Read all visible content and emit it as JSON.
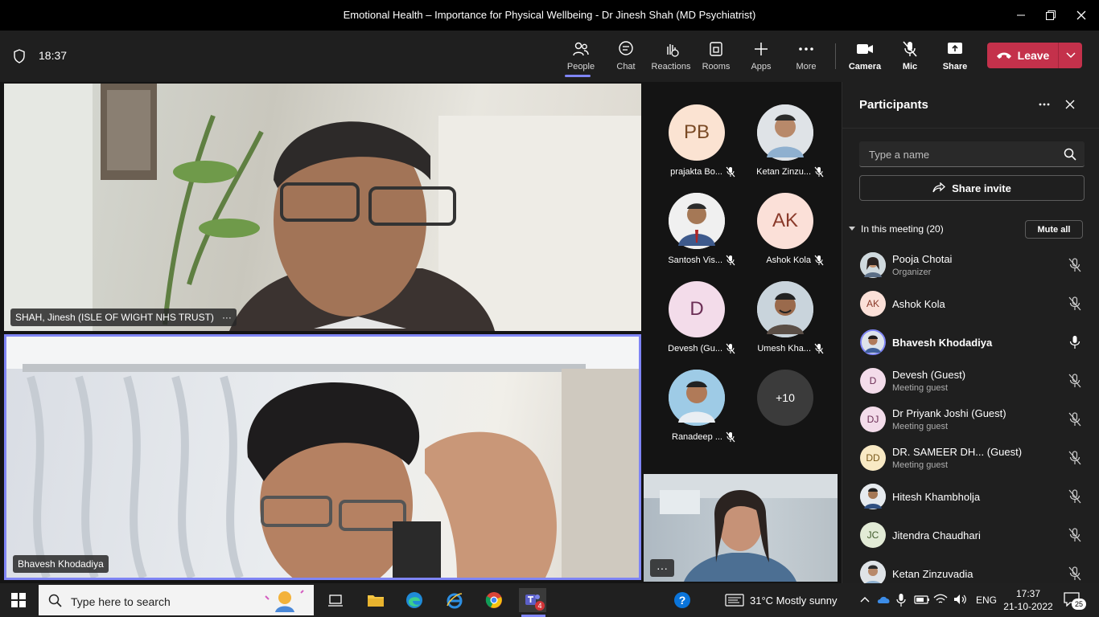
{
  "window": {
    "title": "Emotional Health – Importance for Physical Wellbeing - Dr Jinesh Shah (MD Psychiatrist)"
  },
  "toolbar": {
    "timer": "18:37",
    "people": "People",
    "chat": "Chat",
    "reactions": "Reactions",
    "rooms": "Rooms",
    "apps": "Apps",
    "more": "More",
    "camera": "Camera",
    "mic": "Mic",
    "share": "Share",
    "leave": "Leave"
  },
  "stage": {
    "speaker1": {
      "name": "SHAH, Jinesh (ISLE OF WIGHT NHS TRUST)",
      "more": "···"
    },
    "speaker2": {
      "name": "Bhavesh Khodadiya"
    },
    "small_more": "···",
    "tiles": [
      {
        "initials": "PB",
        "name": "prajakta Bo...",
        "bg": "#fbe3d2",
        "fg": "#7a4a25"
      },
      {
        "initials": "",
        "name": "Ketan Zinzu...",
        "bg": "#cfd6dc",
        "fg": "#333"
      },
      {
        "initials": "",
        "name": "Santosh Vis...",
        "bg": "#e2e2e2",
        "fg": "#333"
      },
      {
        "initials": "AK",
        "name": "Ashok Kola",
        "bg": "#fbe0d8",
        "fg": "#8a3a2a"
      },
      {
        "initials": "D",
        "name": "Devesh (Gu...",
        "bg": "#f3dcea",
        "fg": "#6b2e55"
      },
      {
        "initials": "",
        "name": "Umesh Kha...",
        "bg": "#d7dbdf",
        "fg": "#333"
      },
      {
        "initials": "",
        "name": "Ranadeep ...",
        "bg": "#a9cfe8",
        "fg": "#333"
      },
      {
        "initials": "+10",
        "name": "",
        "bg": "#3b3b3b",
        "fg": "#fff"
      }
    ]
  },
  "panel": {
    "title": "Participants",
    "search_placeholder": "Type a name",
    "share_invite": "Share invite",
    "section": "In this meeting (20)",
    "mute_all": "Mute all",
    "participants": [
      {
        "name": "Pooja Chotai",
        "sub": "Organizer",
        "initials": "",
        "bg": "#d9c4b8"
      },
      {
        "name": "Ashok Kola",
        "sub": "",
        "initials": "AK",
        "bg": "#fbe0d8"
      },
      {
        "name": "Bhavesh Khodadiya",
        "sub": "",
        "initials": "",
        "bg": "#c7d0e0"
      },
      {
        "name": "Devesh (Guest)",
        "sub": "Meeting guest",
        "initials": "D",
        "bg": "#f3dcea"
      },
      {
        "name": "Dr Priyank Joshi (Guest)",
        "sub": "Meeting guest",
        "initials": "DJ",
        "bg": "#f3dcea"
      },
      {
        "name": "DR. SAMEER DH...  (Guest)",
        "sub": "Meeting guest",
        "initials": "DD",
        "bg": "#f8e9c4"
      },
      {
        "name": "Hitesh Khambholja",
        "sub": "",
        "initials": "",
        "bg": "#c9d1dc"
      },
      {
        "name": "Jitendra Chaudhari",
        "sub": "",
        "initials": "JC",
        "bg": "#e2ebd6"
      },
      {
        "name": "Ketan Zinzuvadia",
        "sub": "",
        "initials": "",
        "bg": "#cfd6dc"
      }
    ]
  },
  "taskbar": {
    "search_placeholder": "Type here to search",
    "weather": "31°C  Mostly sunny",
    "lang": "ENG",
    "time": "17:37",
    "date": "21-10-2022",
    "notif_count": "25",
    "teams_badge": "4"
  }
}
